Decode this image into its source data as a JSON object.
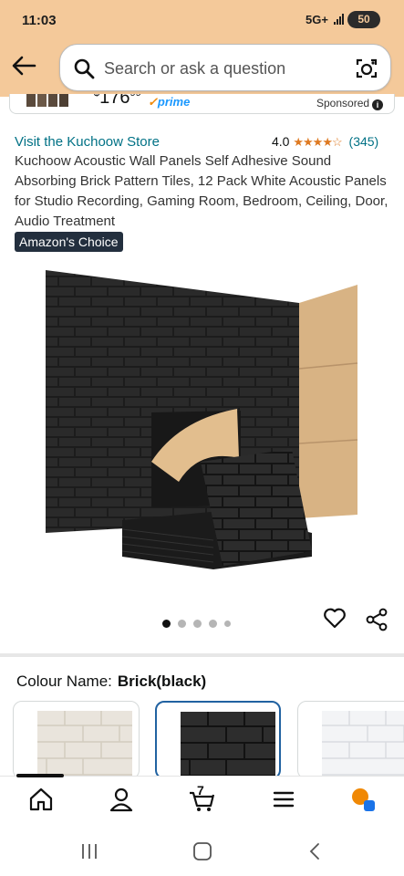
{
  "status_bar": {
    "time": "11:03",
    "network": "5G+",
    "battery": "50"
  },
  "search": {
    "placeholder": "Search or ask a question"
  },
  "sponsored_ad": {
    "price_whole": "176",
    "price_fraction": "99",
    "prime_label": "prime",
    "sponsored_label": "Sponsored"
  },
  "product": {
    "store_link": "Visit the Kuchoow Store",
    "rating_value": "4.0",
    "rating_stars": "★★★★☆",
    "rating_count": "(345)",
    "title": "Kuchoow Acoustic Wall Panels Self Adhesive Sound Absorbing Brick Pattern Tiles, 12 Pack White Acoustic Panels for Studio Recording, Gaming Room, Bedroom, Ceiling, Door, Audio Treatment",
    "badge": "Amazon's Choice",
    "image_count": 5,
    "active_image": 1
  },
  "variation": {
    "label": "Colour Name:",
    "selected": "Brick(black)",
    "swatches": [
      "white-brick",
      "black-brick",
      "white-brick-alt"
    ]
  },
  "bottom_nav": {
    "items": [
      "home-icon",
      "account-icon",
      "cart-icon",
      "menu-icon",
      "rufus-icon"
    ],
    "cart_count": "7"
  },
  "system_nav": [
    "recents-icon",
    "home-button-icon",
    "back-icon"
  ],
  "colors": {
    "header_bg": "#f4c99a",
    "link": "#007185",
    "star": "#de7921",
    "badge_bg": "#232f3e",
    "selected_border": "#2162a1",
    "prime": "#1a98ff"
  }
}
